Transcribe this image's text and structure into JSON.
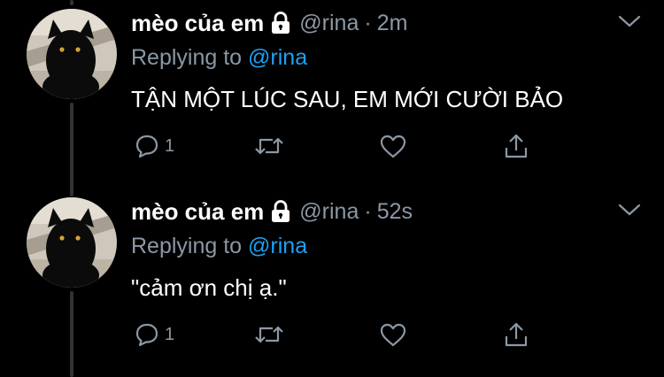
{
  "tweets": [
    {
      "display_name": "mèo của em",
      "handle": "@rina",
      "separator": "·",
      "time": "2m",
      "replying_to_prefix": "Replying to",
      "replying_to_handle": "@rina",
      "text": "TẬN MỘT LÚC SAU, EM MỚI CƯỜI BẢO",
      "reply_count": "1"
    },
    {
      "display_name": "mèo của em",
      "handle": "@rina",
      "separator": "·",
      "time": "52s",
      "replying_to_prefix": "Replying to",
      "replying_to_handle": "@rina",
      "text": "\"cảm ơn chị ạ.\"",
      "reply_count": "1"
    }
  ],
  "icons": {
    "lock": "lock-icon",
    "more": "chevron-down-icon",
    "reply": "comment-icon",
    "retweet": "retweet-icon",
    "like": "heart-icon",
    "share": "share-icon"
  },
  "colors": {
    "background": "#000000",
    "primary_text": "#ffffff",
    "secondary_text": "#8b98a5",
    "mention": "#1da1f2",
    "thread_line": "#2f3336"
  }
}
